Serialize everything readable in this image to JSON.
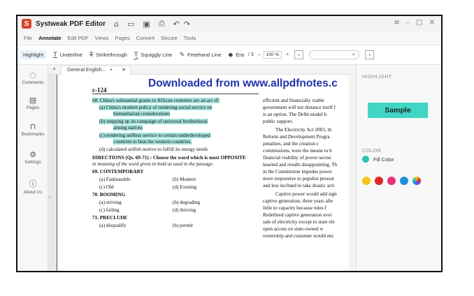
{
  "titlebar": {
    "app_title": "Systweak PDF Editor",
    "window_controls": "≡ – □ ✕"
  },
  "menubar": {
    "items": [
      "File",
      "Annotate",
      "Edit PDF",
      "Views",
      "Pages",
      "Convert",
      "Secure",
      "Tools"
    ],
    "active": "Annotate"
  },
  "toolbar": {
    "highlight": "Highlight",
    "underline": "Underline",
    "strikethrough": "Strikethrough",
    "squiggly": "Squiggly Line",
    "freehand": "Freehand Line",
    "eraser": "Era",
    "page_count": "/ 3",
    "zoom": "100 %",
    "zoom_out": "–",
    "zoom_in": "+"
  },
  "sidebar": {
    "items": [
      {
        "label": "Comments",
        "icon": "comments-icon"
      },
      {
        "label": "Pages",
        "icon": "pages-icon"
      },
      {
        "label": "Bookmarks",
        "icon": "bookmark-icon"
      },
      {
        "label": "Settings",
        "icon": "gear-icon"
      },
      {
        "label": "About Us",
        "icon": "info-icon"
      }
    ]
  },
  "tabs": {
    "current": "General English...",
    "new_tab": "+",
    "close": "✕",
    "modified_dot": "•"
  },
  "document": {
    "banner": "Downloaded from www.allpdfnotes.c",
    "page_number": "c-124",
    "left_lines": [
      "68. China's substantial grants to African countries are an act of:",
      "(a) China's modern policy of rendering social service on",
      "humanitarian considerations",
      "(b) stepping up its campaign of universal brotherhood",
      "among nations",
      "(c) rendering selfless service to certain underdeveloped",
      "countries to beat the western countries.",
      "(d) calculated selfish motive to fulfill its energy needs",
      "DIRECTIONS (Qs. 69-71) : Choose the word which is most OPPOSITE",
      "in meaning of the word given in bold as used in the passage.",
      "69. CONTEMPORARY",
      "(a) Fashionable",
      "(b) Modern",
      "(c) Old",
      "(d) Existing",
      "70. BOOMING",
      "(a) striving",
      "(b) degrading",
      "(c) failing",
      "(d) thriving",
      "71. PRECLUDE",
      "(a) disqualify",
      "(b) permit"
    ],
    "right_lines": [
      "efficient and financially viable",
      "government will not distance itself f",
      "is an option. The Delhi model h",
      "public support.",
      "The Electricity Act 2003, th",
      "Reform and Development Progra",
      "penalties, and the creation c",
      "commissions, were the means to b",
      "financial viability of power sector.",
      "hearted and results disappointing. Th",
      "in the Constitution impedes power",
      "more responsive to populist pressur",
      "and less inclined to take drastic acti",
      "Captive power would add sign",
      "captive generation, three years afte",
      "little to capacity because rules f",
      "Redefined captive generation avoi",
      "sale of electricity except to state ele",
      "open access on state-owned w",
      "ownership and customer would enc"
    ]
  },
  "panel": {
    "highlight_header": "HIGHLIGHT",
    "sample_label": "Sample",
    "color_header": "COLOR",
    "fill_label": "Fill Color",
    "fill_color": "#27c2b2",
    "sample_bg": "#3fd6c4",
    "swatches": [
      "#f5c518",
      "#e02424",
      "#e8327a",
      "#1a8fe0",
      "multicolor"
    ]
  }
}
